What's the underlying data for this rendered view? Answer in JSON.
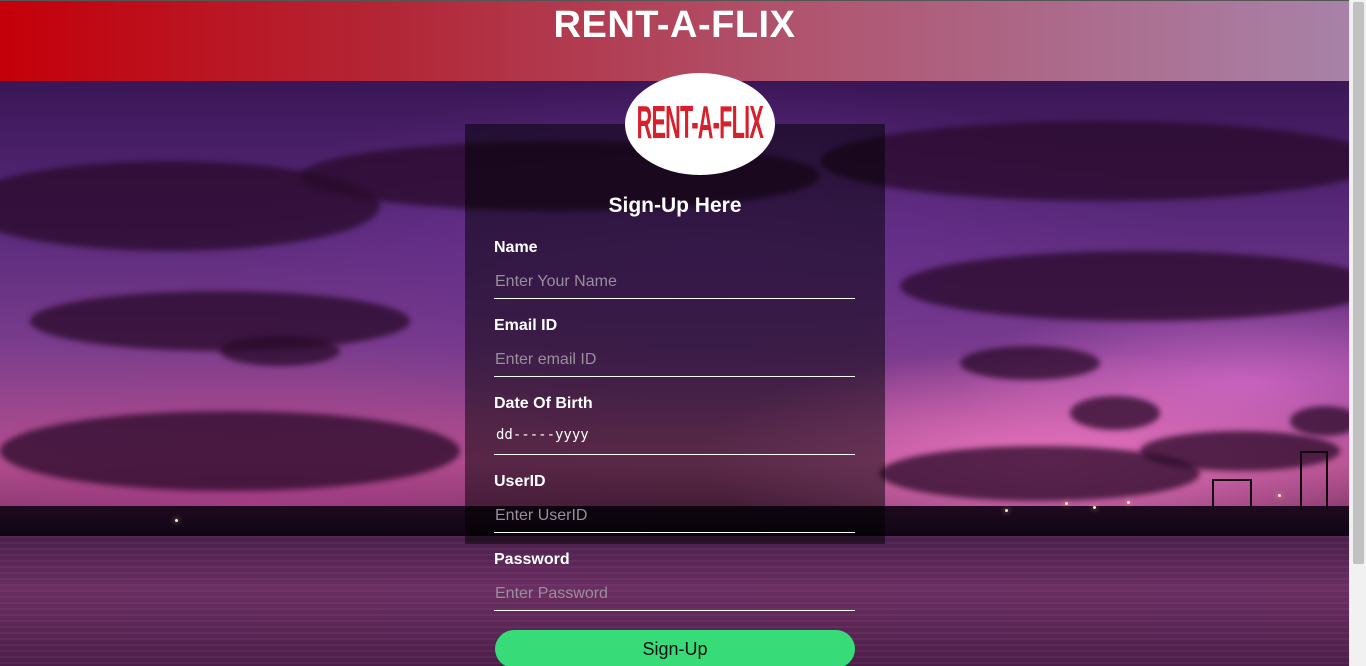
{
  "header": {
    "title": "RENT-A-FLIX"
  },
  "logo": {
    "text": "RENT-A-FLIX"
  },
  "form": {
    "title": "Sign-Up Here",
    "fields": [
      {
        "label": "Name",
        "placeholder": "Enter Your Name"
      },
      {
        "label": "Email ID",
        "placeholder": "Enter email ID"
      },
      {
        "label": "Date Of Birth",
        "value": "dd-----yyyy"
      },
      {
        "label": "UserID",
        "placeholder": "Enter UserID"
      },
      {
        "label": "Password",
        "placeholder": "Enter Password"
      }
    ],
    "submit_label": "Sign-Up"
  },
  "colors": {
    "header_start": "#c4000a",
    "header_end": "#a882a8",
    "button": "#37db77"
  }
}
